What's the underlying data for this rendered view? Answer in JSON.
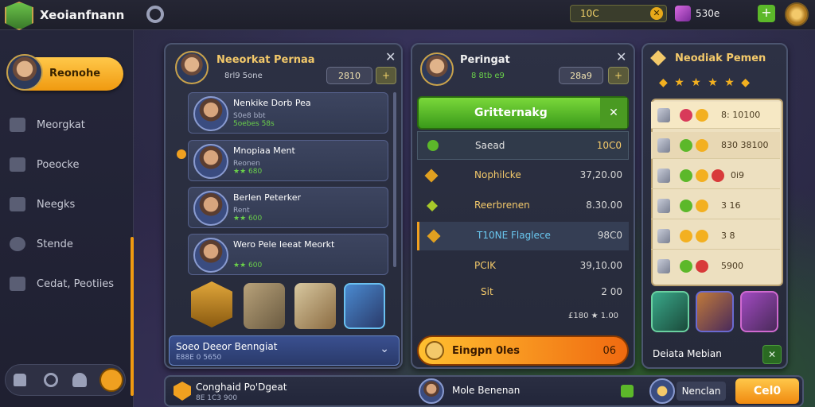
{
  "topbar": {
    "app_name": "Xeoianfnann",
    "currency1": "10C",
    "currency2": "530e"
  },
  "sidebar": {
    "profile_button": "Reonohe",
    "items": [
      {
        "label": "Meorgkat"
      },
      {
        "label": "Poeocke"
      },
      {
        "label": "Neegks"
      },
      {
        "label": "Stende"
      },
      {
        "label": "Cedat, Peotiies"
      }
    ]
  },
  "panel1": {
    "title": "Neeorkat Pernaa",
    "subtitle": "8rl9 5one",
    "cost": "2810",
    "heroes": [
      {
        "name": "Nenkike Dorb Pea",
        "sub": "S0e8 bbt",
        "stars": "5oebes 58s"
      },
      {
        "name": "Mnopiaa Ment",
        "sub": "Reonen",
        "stars": "★★ 680"
      },
      {
        "name": "Berlen Peterker",
        "sub": "Rent",
        "stars": "★★ 600"
      },
      {
        "name": "Wero Pele Ieeat Meorkt",
        "sub": "",
        "stars": "★★ 600"
      }
    ],
    "dropdown_title": "Soeo Deeor Benngiat",
    "dropdown_sub": "E88E 0 5650"
  },
  "panel2": {
    "title": "Peringat",
    "subtitle": "8 8tb e9",
    "cost": "28a9",
    "banner": "Gritternakg",
    "rows": [
      {
        "label": "Saead",
        "value": "10C0"
      },
      {
        "label": "Nophilcke",
        "value": "37,20.00"
      },
      {
        "label": "Reerbrenen",
        "value": "8.30.00"
      },
      {
        "label": "T10NE Flaglece",
        "value": "98C0"
      },
      {
        "label": "PCIK",
        "value": "39,10.00"
      },
      {
        "label": "Sit",
        "value": "2 00"
      }
    ],
    "footer_value": "£180 ★ 1.00",
    "claim_button": "Eingpn 0les",
    "claim_value": "06"
  },
  "panel3": {
    "title": "Neodiak Pemen",
    "rewards": [
      {
        "value": "8: 10100"
      },
      {
        "value": "830 38100"
      },
      {
        "value": "0i9"
      },
      {
        "value": "3 16"
      },
      {
        "value": "3 8"
      },
      {
        "value": "5900"
      }
    ],
    "footer_label": "Deiata Mebian"
  },
  "bottombar": {
    "left_title": "Conghaid Po'Dgeat",
    "left_sub": "8E 1C3 900",
    "middle": "Mole Benenan",
    "right_label": "Nenclan",
    "call_button": "Cel0"
  },
  "colors": {
    "accent_orange": "#f0a020",
    "accent_green": "#5cb82a",
    "gold": "#f3c96a"
  }
}
